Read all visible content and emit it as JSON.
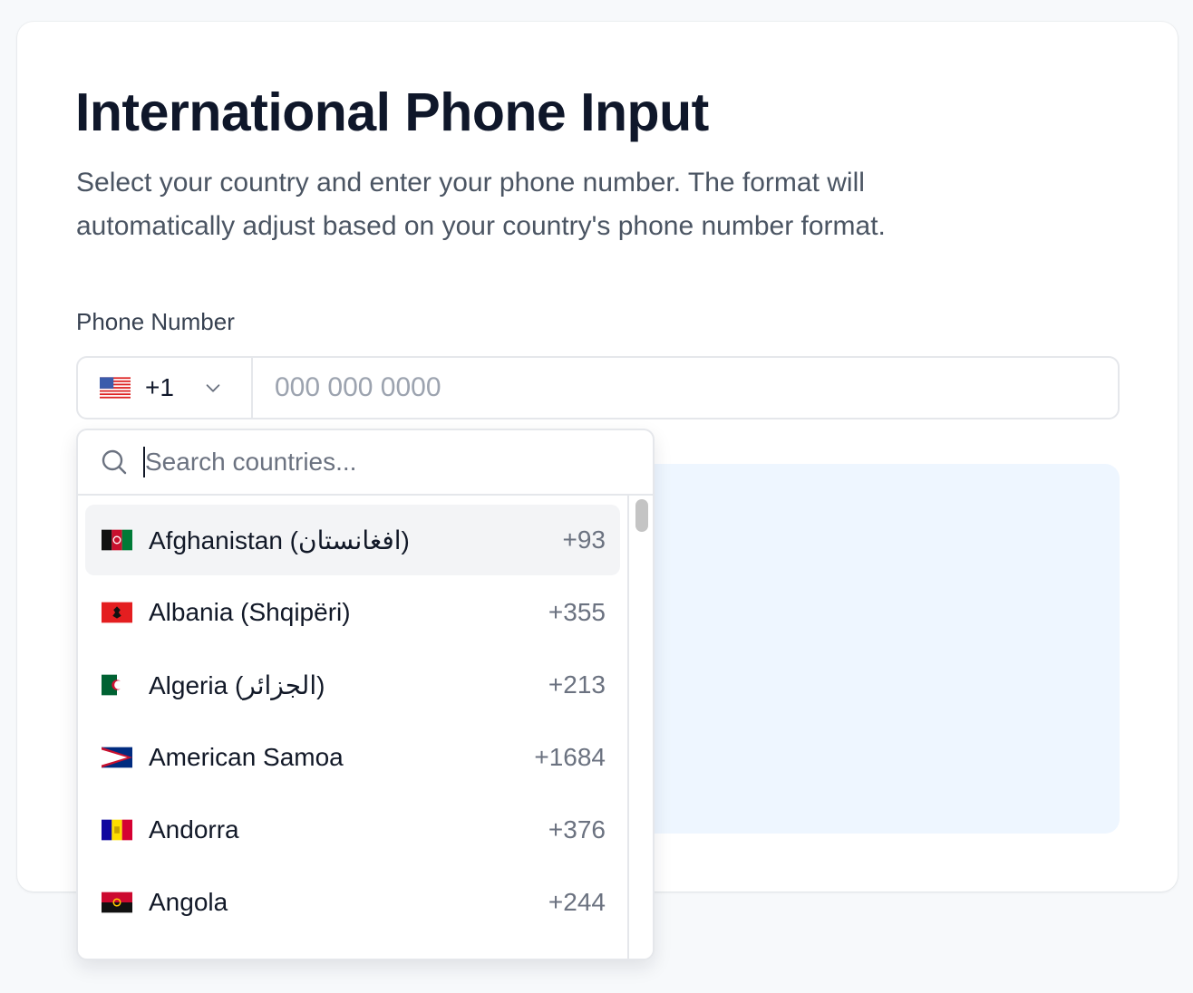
{
  "title": "International Phone Input",
  "description": "Select your country and enter your phone number. The format will automatically adjust based on your country's phone number format.",
  "field_label": "Phone Number",
  "selected_country": {
    "flag_icon": "us-flag-icon",
    "dial_code": "+1"
  },
  "phone_input": {
    "value": "",
    "placeholder": "000 000 0000"
  },
  "search": {
    "value": "",
    "placeholder": "Search countries..."
  },
  "countries": [
    {
      "name": "Afghanistan (افغانستان)",
      "dial": "+93",
      "flag_icon": "af-flag-icon",
      "highlighted": true
    },
    {
      "name": "Albania (Shqipëri)",
      "dial": "+355",
      "flag_icon": "al-flag-icon"
    },
    {
      "name": "Algeria (الجزائر)",
      "dial": "+213",
      "flag_icon": "dz-flag-icon"
    },
    {
      "name": "American Samoa",
      "dial": "+1684",
      "flag_icon": "as-flag-icon"
    },
    {
      "name": "Andorra",
      "dial": "+376",
      "flag_icon": "ad-flag-icon"
    },
    {
      "name": "Angola",
      "dial": "+244",
      "flag_icon": "ao-flag-icon"
    }
  ],
  "colors": {
    "highlight_bg": "#f3f4f6",
    "info_panel_bg": "#eef6ff",
    "border": "#e5e7eb"
  }
}
